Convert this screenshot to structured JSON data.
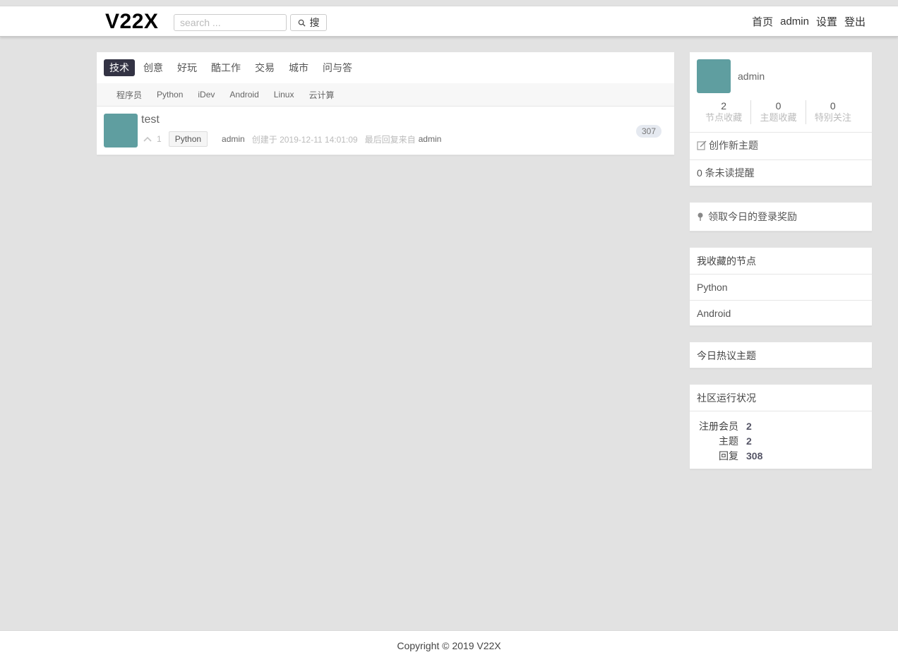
{
  "header": {
    "logo": "V22X",
    "search_placeholder": "search ...",
    "search_button": "搜",
    "nav": [
      "首页",
      "admin",
      "设置",
      "登出"
    ]
  },
  "tabs": [
    "技术",
    "创意",
    "好玩",
    "酷工作",
    "交易",
    "城市",
    "问与答"
  ],
  "active_tab": "技术",
  "subtabs": [
    "程序员",
    "Python",
    "iDev",
    "Android",
    "Linux",
    "云计算"
  ],
  "topics": [
    {
      "title": "test",
      "votes": "1",
      "node": "Python",
      "author": "admin",
      "created": "创建于 2019-12-11 14:01:09",
      "last_reply_prefix": "最后回复来自",
      "last_reply_user": "admin",
      "replies": "307"
    }
  ],
  "sidebar": {
    "user": {
      "name": "admin",
      "stats": [
        {
          "num": "2",
          "label": "节点收藏"
        },
        {
          "num": "0",
          "label": "主题收藏"
        },
        {
          "num": "0",
          "label": "特别关注"
        }
      ],
      "new_topic": "创作新主题",
      "notifications": "0 条未读提醒"
    },
    "reward": "领取今日的登录奖励",
    "fav_nodes": {
      "title": "我收藏的节点",
      "items": [
        "Python",
        "Android"
      ]
    },
    "hot_topics_title": "今日热议主题",
    "community": {
      "title": "社区运行状况",
      "rows": [
        {
          "key": "注册会员",
          "val": "2"
        },
        {
          "key": "主题",
          "val": "2"
        },
        {
          "key": "回复",
          "val": "308"
        }
      ]
    }
  },
  "footer": "Copyright © 2019 V22X",
  "colors": {
    "avatar": "#5f9ea0",
    "active_tab": "#333344",
    "background": "#e2e2e2"
  }
}
